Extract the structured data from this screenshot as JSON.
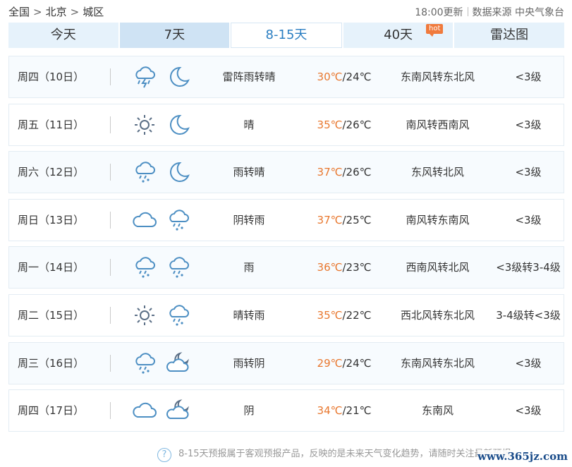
{
  "breadcrumb": {
    "items": [
      "全国",
      "北京",
      "城区"
    ],
    "separator": ">"
  },
  "meta": {
    "update": "18:00更新",
    "source": "数据来源 中央气象台"
  },
  "tabs": [
    {
      "label": "今天"
    },
    {
      "label": "7天"
    },
    {
      "label": "8-15天",
      "state": "selected"
    },
    {
      "label": "40天",
      "badge": "hot"
    },
    {
      "label": "雷达图"
    }
  ],
  "colors": {
    "accent": "#2a7ec2",
    "high_temp": "#e8772e",
    "tab_bg": "#e6f2fb",
    "icon_stroke": "#4d8fc3",
    "sun": "#5b6f86"
  },
  "forecast": [
    {
      "date": "周四（10日）",
      "day_icon": "thunder-rain-icon",
      "night_icon": "moon-icon",
      "desc": "雷阵雨转晴",
      "high": "30℃",
      "low": "/24℃",
      "wind": "东南风转东北风",
      "level": "<3级"
    },
    {
      "date": "周五（11日）",
      "day_icon": "sun-icon",
      "night_icon": "moon-icon",
      "desc": "晴",
      "high": "35℃",
      "low": "/26℃",
      "wind": "南风转西南风",
      "level": "<3级"
    },
    {
      "date": "周六（12日）",
      "day_icon": "rain-icon",
      "night_icon": "moon-icon",
      "desc": "雨转晴",
      "high": "37℃",
      "low": "/26℃",
      "wind": "东风转北风",
      "level": "<3级"
    },
    {
      "date": "周日（13日）",
      "day_icon": "cloud-icon",
      "night_icon": "rain-icon",
      "desc": "阴转雨",
      "high": "37℃",
      "low": "/25℃",
      "wind": "南风转东南风",
      "level": "<3级"
    },
    {
      "date": "周一（14日）",
      "day_icon": "rain-icon",
      "night_icon": "rain-icon",
      "desc": "雨",
      "high": "36℃",
      "low": "/23℃",
      "wind": "西南风转北风",
      "level": "<3级转3-4级"
    },
    {
      "date": "周二（15日）",
      "day_icon": "sun-icon",
      "night_icon": "rain-icon",
      "desc": "晴转雨",
      "high": "35℃",
      "low": "/22℃",
      "wind": "西北风转东北风",
      "level": "3-4级转<3级"
    },
    {
      "date": "周三（16日）",
      "day_icon": "rain-icon",
      "night_icon": "moon-cloud-icon",
      "desc": "雨转阴",
      "high": "29℃",
      "low": "/24℃",
      "wind": "东南风转东北风",
      "level": "<3级"
    },
    {
      "date": "周四（17日）",
      "day_icon": "cloud-icon",
      "night_icon": "moon-cloud-icon",
      "desc": "阴",
      "high": "34℃",
      "low": "/21℃",
      "wind": "东南风",
      "level": "<3级"
    }
  ],
  "footnote": {
    "icon": "question-icon",
    "text": "8-15天预报属于客观预报产品，反映的是未来天气变化趋势，请随时关注最新预报。"
  },
  "watermark": "www.365jz.com"
}
